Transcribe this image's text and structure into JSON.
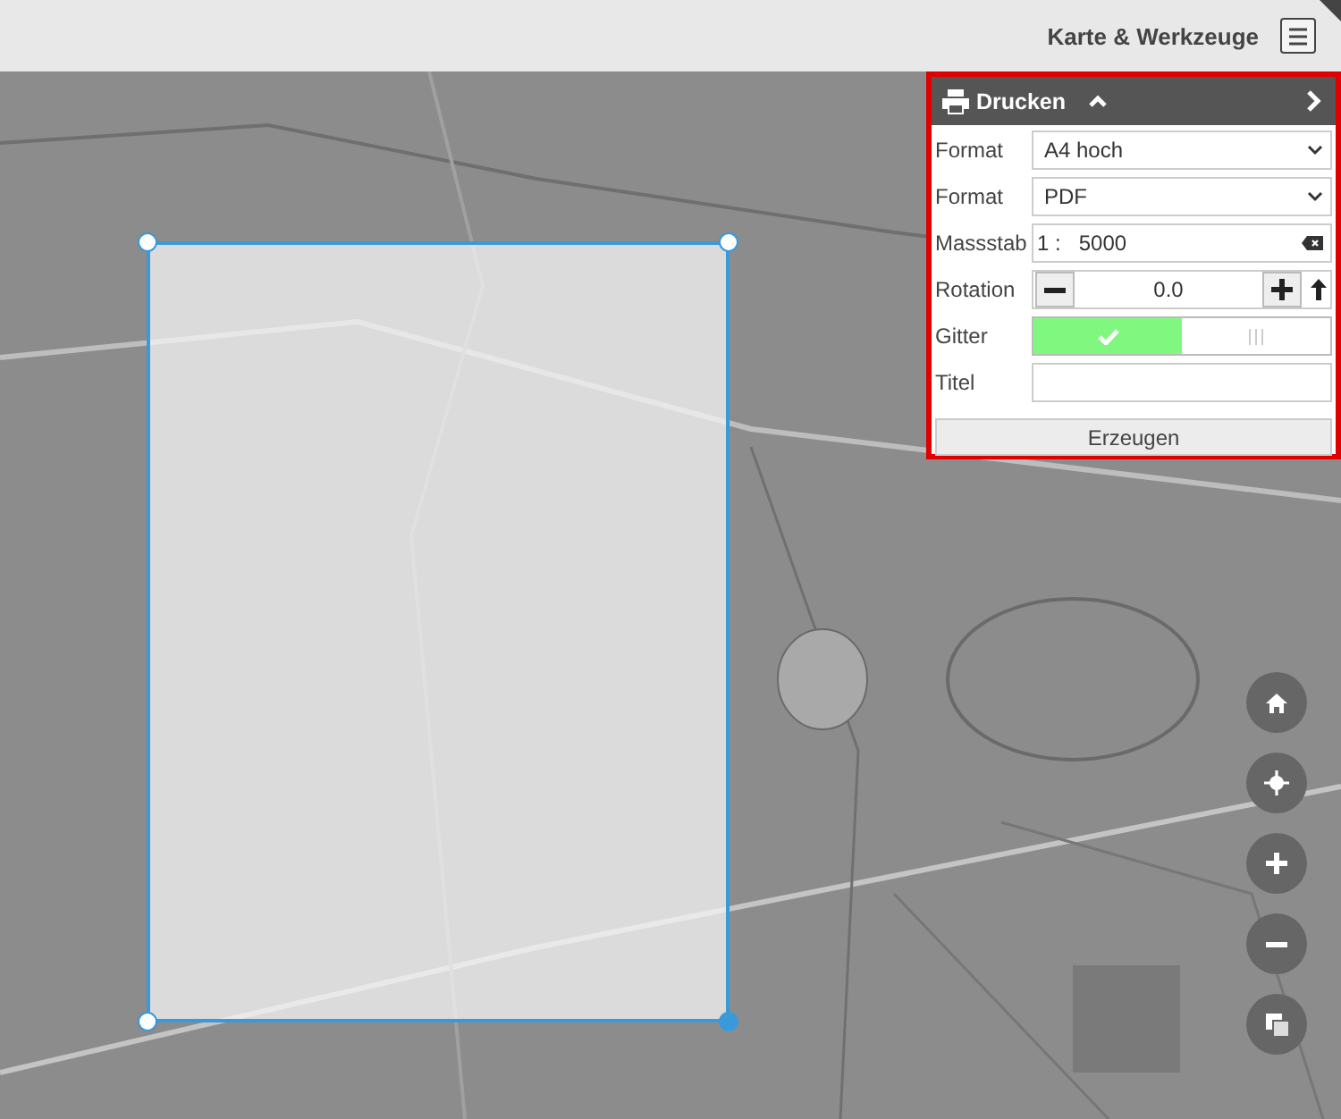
{
  "header": {
    "title": "Karte & Werkzeuge"
  },
  "print_panel": {
    "title": "Drucken",
    "expanded": true,
    "rows": [
      {
        "kind": "select",
        "label": "Format",
        "value": "A4 hoch"
      },
      {
        "kind": "select",
        "label": "Format",
        "value": "PDF"
      },
      {
        "kind": "scale",
        "label": "Massstab",
        "prefix": "1 :",
        "value": "5000"
      },
      {
        "kind": "stepper",
        "label": "Rotation",
        "value": "0.0"
      },
      {
        "kind": "toggle",
        "label": "Gitter",
        "on": true
      },
      {
        "kind": "text",
        "label": "Titel"
      }
    ],
    "button": "Erzeugen"
  }
}
